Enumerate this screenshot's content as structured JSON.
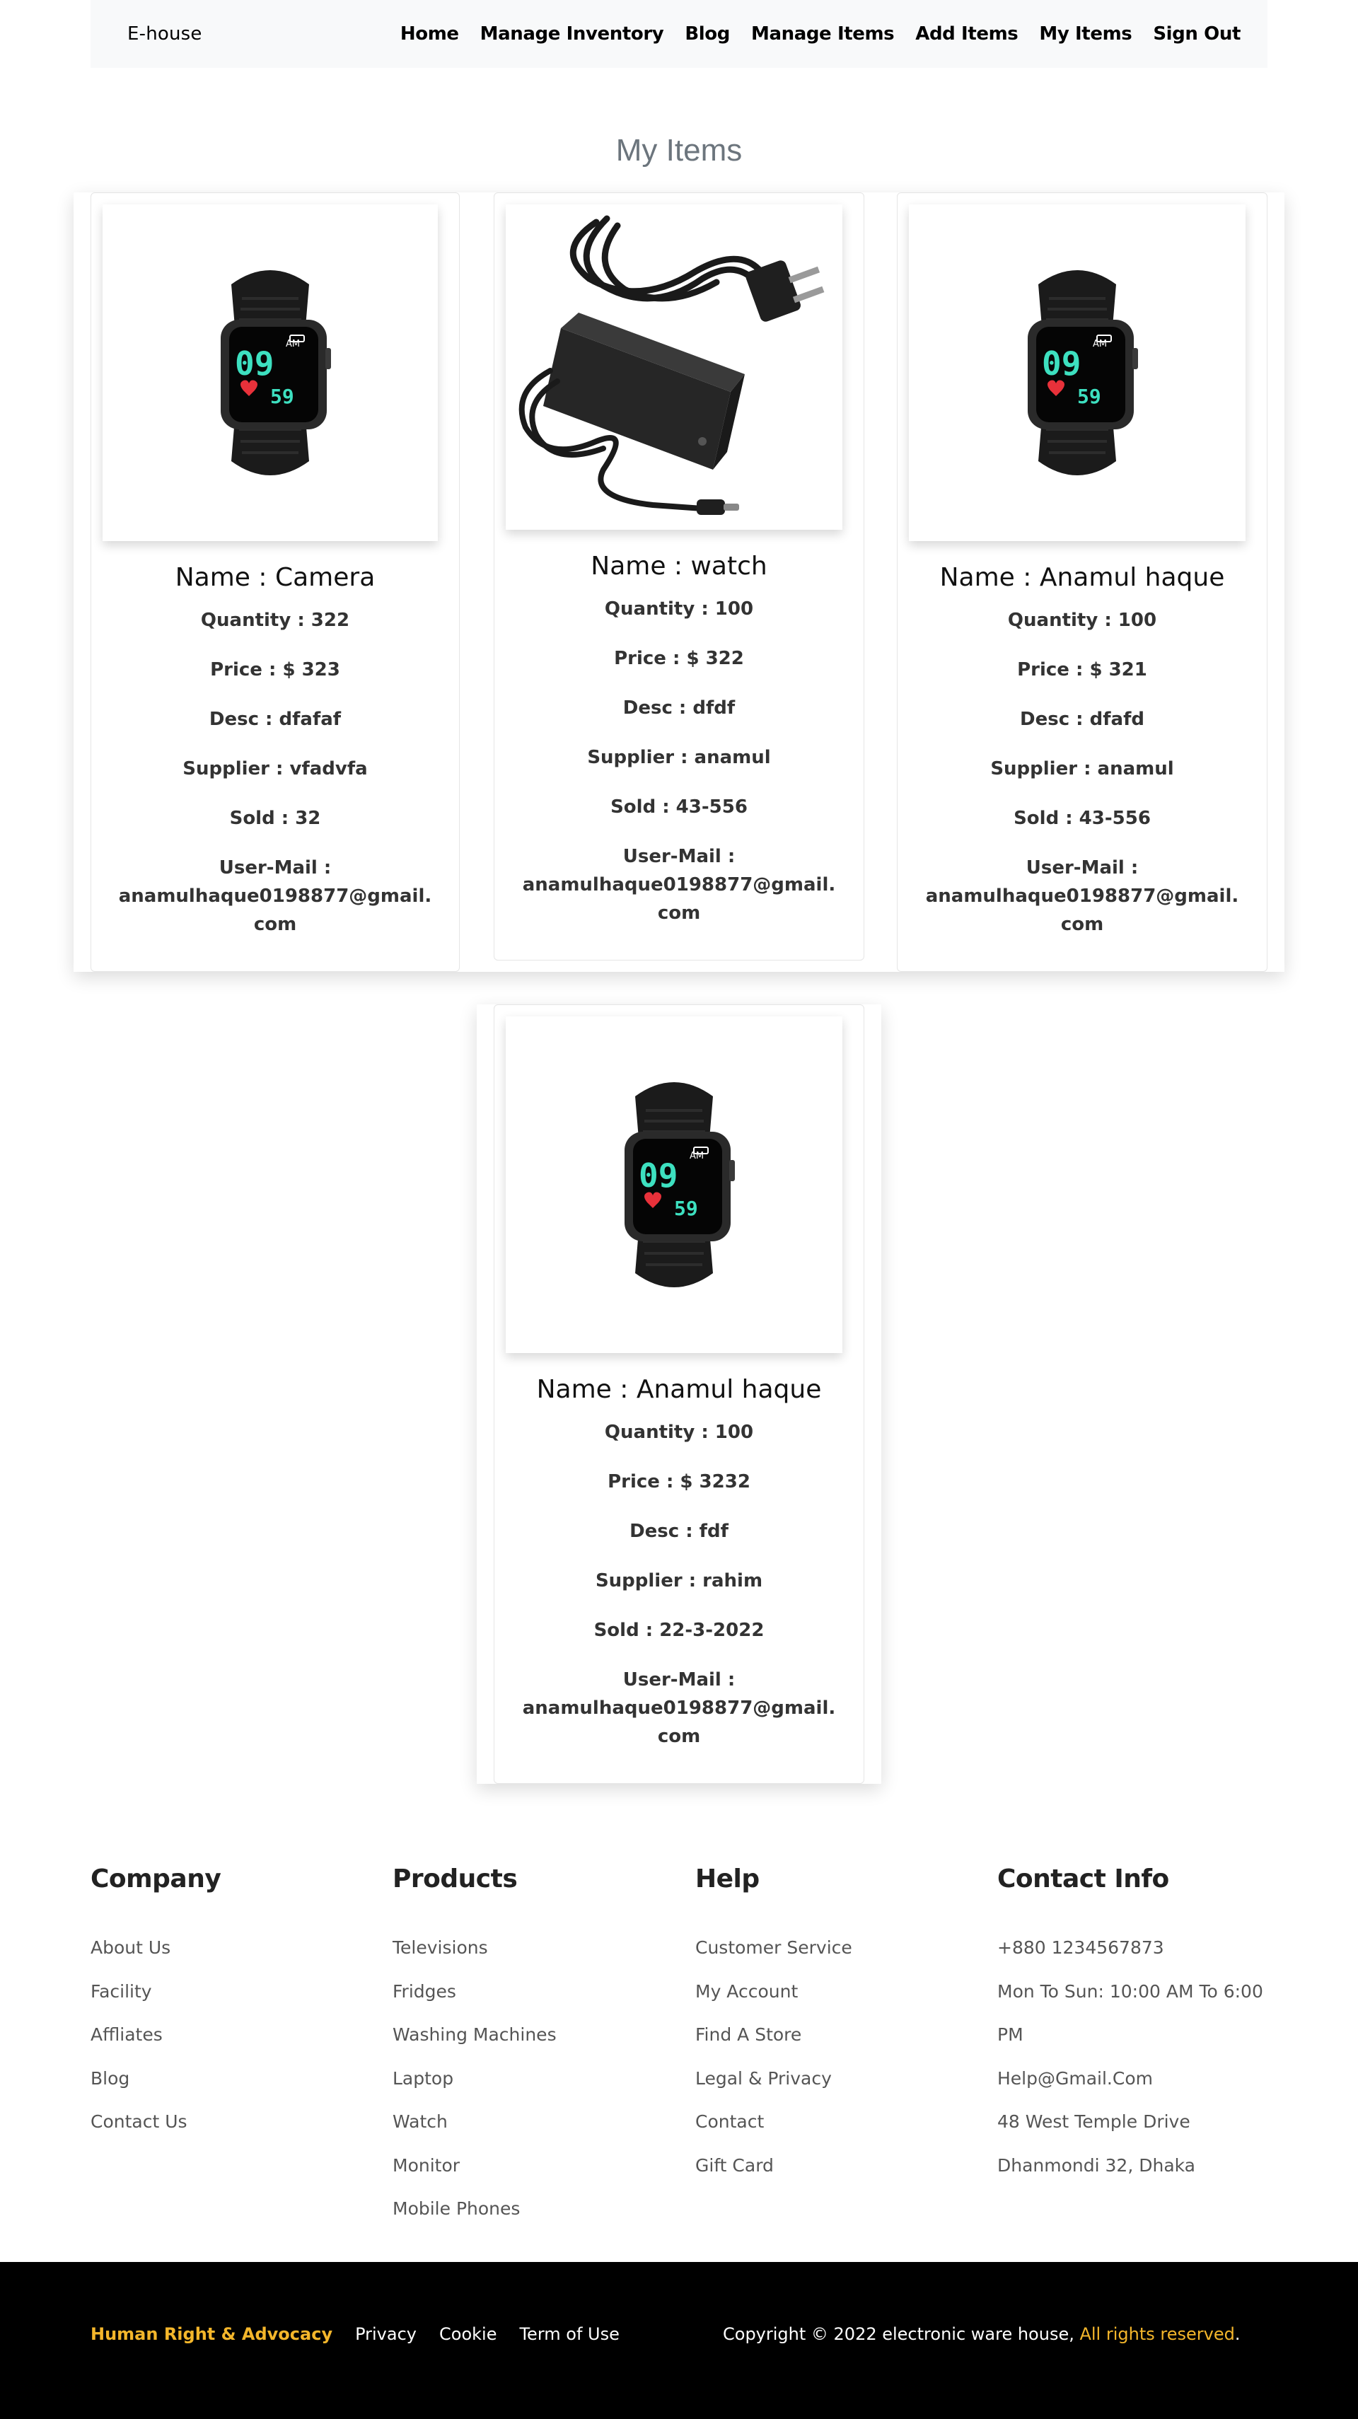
{
  "nav": {
    "brand": "E-house",
    "links": [
      "Home",
      "Manage Inventory",
      "Blog",
      "Manage Items",
      "Add Items",
      "My Items",
      "Sign Out"
    ]
  },
  "page_title": "My Items",
  "cards": [
    {
      "image": "smartwatch-image",
      "name": "Name : Camera",
      "quantity": "Quantity : 322",
      "price": "Price : $ 323",
      "desc": "Desc : dfafaf",
      "supplier": "Supplier : vfadvfa",
      "sold": "Sold : 32",
      "user_mail_label": "User-Mail :",
      "user_mail": "anamulhaque0198877@gmail.com"
    },
    {
      "image": "power-adapter-image",
      "name": "Name : watch",
      "quantity": "Quantity : 100",
      "price": "Price : $ 322",
      "desc": "Desc : dfdf",
      "supplier": "Supplier : anamul",
      "sold": "Sold : 43-556",
      "user_mail_label": "User-Mail :",
      "user_mail": "anamulhaque0198877@gmail.com"
    },
    {
      "image": "smartwatch-image",
      "name": "Name : Anamul haque",
      "quantity": "Quantity : 100",
      "price": "Price : $ 321",
      "desc": "Desc : dfafd",
      "supplier": "Supplier : anamul",
      "sold": "Sold : 43-556",
      "user_mail_label": "User-Mail :",
      "user_mail": "anamulhaque0198877@gmail.com"
    },
    {
      "image": "smartwatch-image",
      "name": "Name : Anamul haque",
      "quantity": "Quantity : 100",
      "price": "Price : $ 3232",
      "desc": "Desc : fdf",
      "supplier": "Supplier : rahim",
      "sold": "Sold : 22-3-2022",
      "user_mail_label": "User-Mail :",
      "user_mail": "anamulhaque0198877@gmail.com"
    }
  ],
  "watch_display": {
    "time_hour": "09",
    "time_min": "59",
    "ampm": "AM"
  },
  "footer": {
    "company": {
      "title": "Company",
      "links": [
        "About Us",
        "Facility",
        "Affliates",
        "Blog",
        "Contact Us"
      ]
    },
    "products": {
      "title": "Products",
      "links": [
        "Televisions",
        "Fridges",
        "Washing Machines",
        "Laptop",
        "Watch",
        "Monitor",
        "Mobile Phones"
      ]
    },
    "help": {
      "title": "Help",
      "links": [
        "Customer Service",
        "My Account",
        "Find A Store",
        "Legal & Privacy",
        "Contact",
        "Gift Card"
      ]
    },
    "contact": {
      "title": "Contact Info",
      "phone": "+880 1234567873",
      "hours_1": "Mon To Sun: 10:00 AM To 6:00",
      "hours_2": "PM",
      "email": "Help@Gmail.Com",
      "address_1": "48 West Temple Drive",
      "address_2": "Dhanmondi 32, Dhaka"
    },
    "bottom": {
      "advocacy": "Human Right & Advocacy",
      "privacy": "Privacy",
      "cookie": "Cookie",
      "terms": "Term of Use",
      "copyright": "Copyright © 2022 electronic ware house, ",
      "rights": "All rights reserved",
      "period": "."
    }
  },
  "colors": {
    "nav_bg": "#f8f9fa",
    "title_gray": "#6c757d",
    "accent": "#f4b62b",
    "footer_bg": "#000000",
    "watch_digits": "#3de0c0",
    "heart": "#e8313a"
  }
}
